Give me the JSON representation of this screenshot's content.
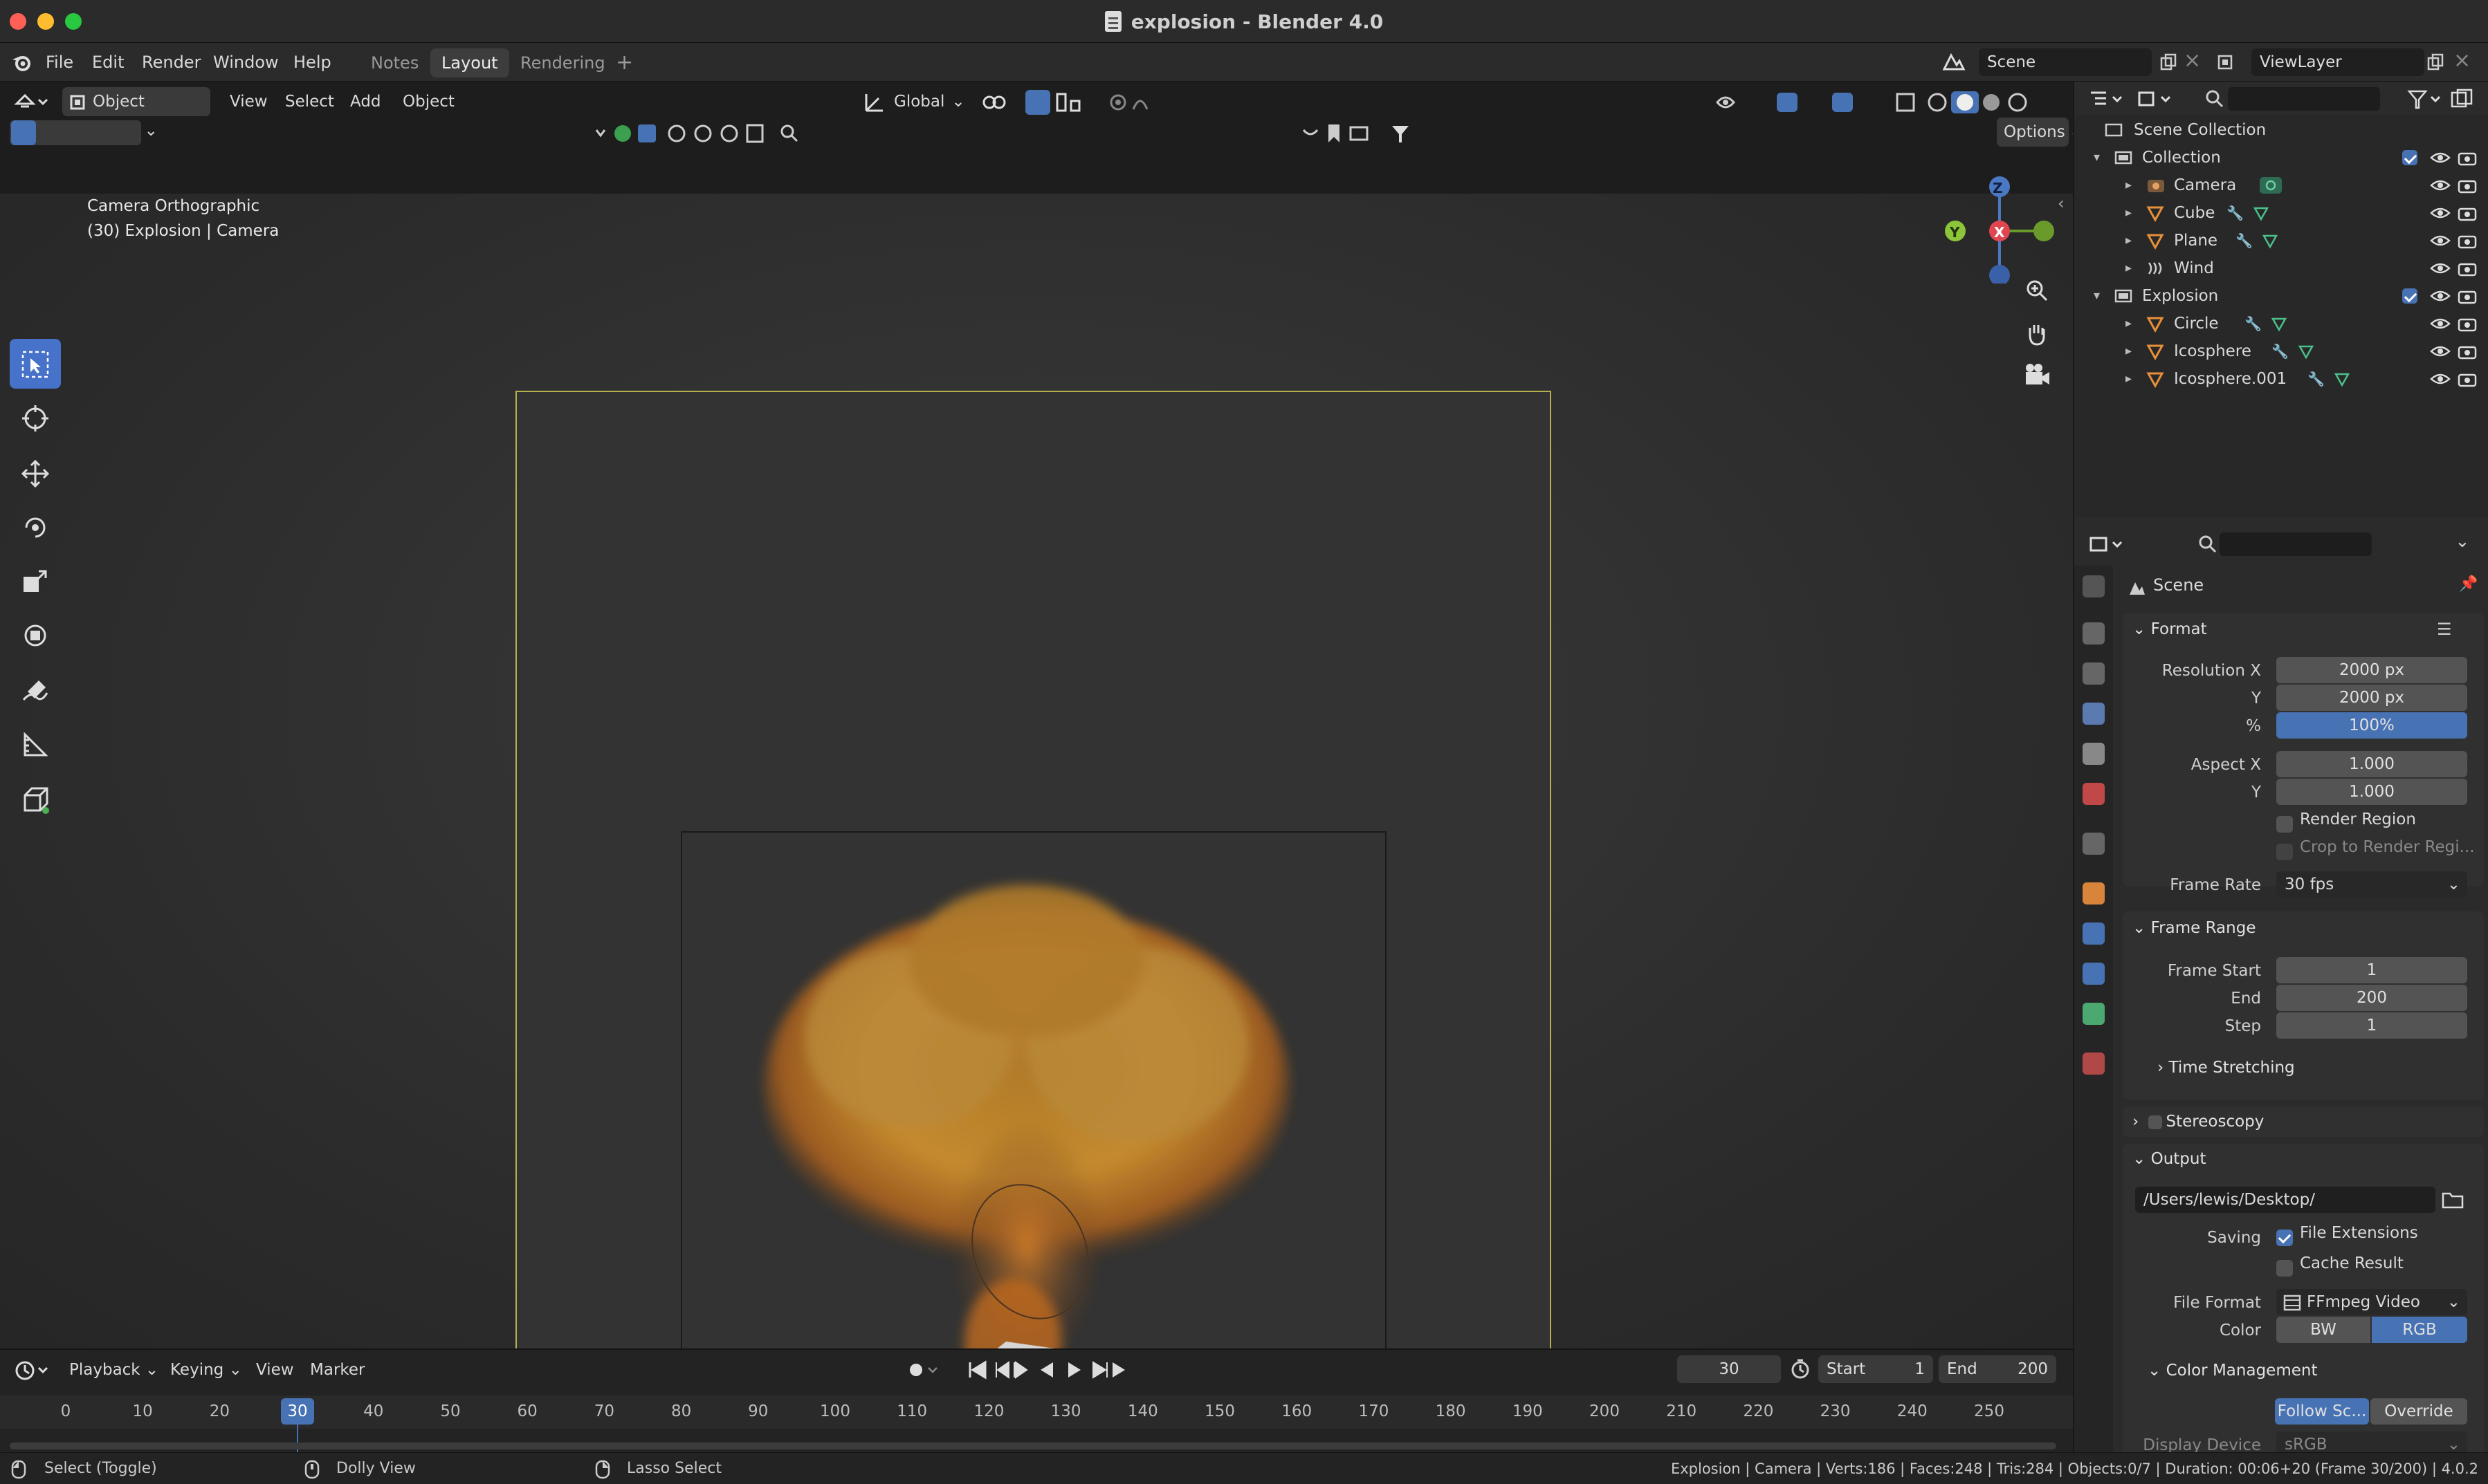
{
  "window": {
    "title": "explosion - Blender 4.0"
  },
  "menu": {
    "items": [
      "File",
      "Edit",
      "Render",
      "Window",
      "Help"
    ],
    "workspace_tabs": [
      "Notes",
      "Layout",
      "Rendering"
    ],
    "active_tab": "Layout",
    "add_tab": "+",
    "scene": "Scene",
    "view_layer": "ViewLayer"
  },
  "header": {
    "mode": "Object Mode",
    "menus": [
      "View",
      "Select",
      "Add",
      "Object"
    ],
    "transform_orientation": "Global",
    "options": "Options"
  },
  "viewport": {
    "overlay_line1": "Camera Orthographic",
    "overlay_line2": "(30) Explosion | Camera",
    "gizmo_axes": {
      "z": "Z",
      "y": "Y",
      "x": "X"
    }
  },
  "outliner": {
    "root": "Scene Collection",
    "rows": [
      {
        "name": "Collection",
        "indent": 0,
        "type": "collection"
      },
      {
        "name": "Camera",
        "indent": 1,
        "type": "camera"
      },
      {
        "name": "Cube",
        "indent": 1,
        "type": "mesh"
      },
      {
        "name": "Plane",
        "indent": 1,
        "type": "mesh"
      },
      {
        "name": "Wind",
        "indent": 1,
        "type": "force"
      },
      {
        "name": "Explosion",
        "indent": 0,
        "type": "collection"
      },
      {
        "name": "Circle",
        "indent": 1,
        "type": "mesh"
      },
      {
        "name": "Icosphere",
        "indent": 1,
        "type": "mesh"
      },
      {
        "name": "Icosphere.001",
        "indent": 1,
        "type": "mesh"
      }
    ]
  },
  "properties": {
    "context": "Scene",
    "format": {
      "header": "Format",
      "res_x_label": "Resolution X",
      "res_x": "2000 px",
      "res_y_label": "Y",
      "res_y": "2000 px",
      "pct_label": "%",
      "pct": "100%",
      "aspect_x_label": "Aspect X",
      "aspect_x": "1.000",
      "aspect_y_label": "Y",
      "aspect_y": "1.000",
      "render_region": "Render Region",
      "crop": "Crop to Render Regi...",
      "frame_rate_label": "Frame Rate",
      "frame_rate": "30 fps"
    },
    "frame_range": {
      "header": "Frame Range",
      "start_label": "Frame Start",
      "start": "1",
      "end_label": "End",
      "end": "200",
      "step_label": "Step",
      "step": "1",
      "time_stretching": "Time Stretching"
    },
    "stereoscopy": {
      "header": "Stereoscopy"
    },
    "output": {
      "header": "Output",
      "path": "/Users/lewis/Desktop/",
      "saving_label": "Saving",
      "file_extensions": "File Extensions",
      "cache_result": "Cache Result",
      "file_format_label": "File Format",
      "file_format": "FFmpeg Video",
      "color_label": "Color",
      "color_bw": "BW",
      "color_rgb": "RGB",
      "color_management": "Color Management",
      "follow_scene": "Follow Sc...",
      "override": "Override",
      "display_device_label": "Display Device",
      "display_device": "sRGB"
    }
  },
  "timeline": {
    "menus": [
      "Playback",
      "Keying",
      "View",
      "Marker"
    ],
    "current_frame": "30",
    "start_label": "Start",
    "start": "1",
    "end_label": "End",
    "end": "200",
    "ticks": [
      "0",
      "10",
      "20",
      "30",
      "40",
      "50",
      "60",
      "70",
      "80",
      "90",
      "100",
      "110",
      "120",
      "130",
      "140",
      "150",
      "160",
      "170",
      "180",
      "190",
      "200",
      "210",
      "220",
      "230",
      "240",
      "250"
    ],
    "playhead": "30"
  },
  "status": {
    "select": "Select (Toggle)",
    "dolly": "Dolly View",
    "lasso": "Lasso Select",
    "stats": "Explosion | Camera | Verts:186 | Faces:248 | Tris:284 | Objects:0/7 | Duration: 00:06+20 (Frame 30/200) | 4.0.2"
  },
  "colors": {
    "accent": "#4772b3",
    "camera_frame": "#b5b04b",
    "fire": "#c58a2e"
  }
}
